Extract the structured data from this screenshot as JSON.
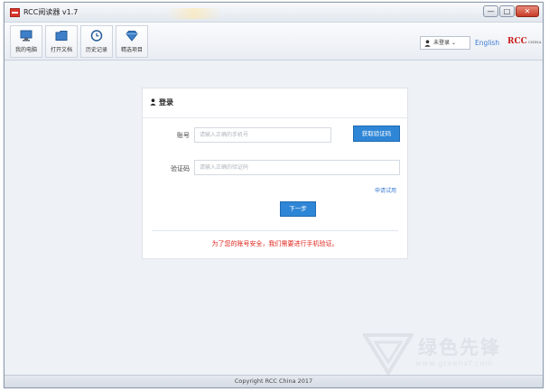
{
  "window": {
    "title": "RCC阅读器 v1.7",
    "controls": {
      "minimize": "—",
      "maximize": "□",
      "close": "✕"
    }
  },
  "toolbar": {
    "items": [
      {
        "label": "我的电脑",
        "icon": "computer-icon"
      },
      {
        "label": "打开文档",
        "icon": "folder-icon"
      },
      {
        "label": "历史记录",
        "icon": "clock-icon"
      },
      {
        "label": "精选项目",
        "icon": "diamond-icon"
      }
    ],
    "user_menu": "未登录",
    "user_menu_caret": "⌄",
    "language": "English",
    "brand": "RCC",
    "brand_sub": "CHINA"
  },
  "login": {
    "title": "登录",
    "account_label": "账号",
    "account_placeholder": "请输入正确的手机号",
    "get_code_button": "获取验证码",
    "code_label": "验证码",
    "code_placeholder": "请输入正确的验证码",
    "apply_trial": "申请试用",
    "next_button": "下一步",
    "notice": "为了您的账号安全，我们需要进行手机验证。"
  },
  "watermark": {
    "text": "绿色先锋",
    "url": "www.greenxf.com"
  },
  "statusbar": {
    "copyright": "Copyright RCC China 2017"
  },
  "colors": {
    "accent": "#2f86d6",
    "notice": "#e0241b",
    "brand": "#c8201d",
    "link": "#3a7bd5"
  }
}
